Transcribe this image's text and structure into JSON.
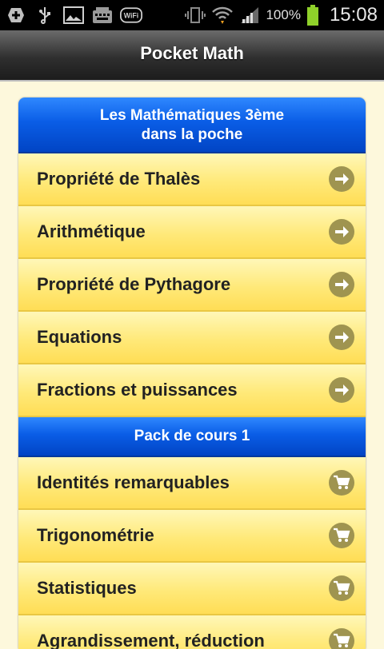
{
  "status_bar": {
    "battery_percent": "100%",
    "time": "15:08",
    "icons": [
      "add-icon",
      "usb-icon",
      "image-icon",
      "keyboard-icon",
      "wifi-direct-icon",
      "vibrate-icon",
      "wifi-icon",
      "signal-icon",
      "battery-icon"
    ]
  },
  "app": {
    "title": "Pocket Math"
  },
  "main_header": {
    "line1": "Les Mathématiques 3ème",
    "line2": "dans la poche"
  },
  "free_items": [
    {
      "label": "Propriété de Thalès",
      "icon": "arrow-right-icon"
    },
    {
      "label": "Arithmétique",
      "icon": "arrow-right-icon"
    },
    {
      "label": "Propriété de Pythagore",
      "icon": "arrow-right-icon"
    },
    {
      "label": "Equations",
      "icon": "arrow-right-icon"
    },
    {
      "label": "Fractions et puissances",
      "icon": "arrow-right-icon"
    }
  ],
  "pack_header": {
    "label": "Pack de cours 1"
  },
  "pack_items": [
    {
      "label": "Identités remarquables",
      "icon": "cart-icon"
    },
    {
      "label": "Trigonométrie",
      "icon": "cart-icon"
    },
    {
      "label": "Statistiques",
      "icon": "cart-icon"
    },
    {
      "label": "Agrandissement, réduction",
      "icon": "cart-icon"
    }
  ],
  "colors": {
    "background": "#fdf8dc",
    "header_blue": "#0a5de6",
    "row_yellow": "#ffe979",
    "badge": "#9f9450"
  }
}
